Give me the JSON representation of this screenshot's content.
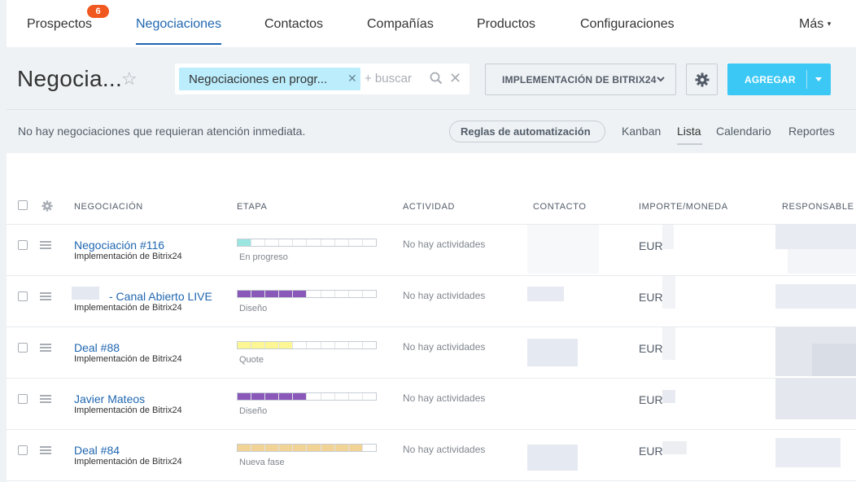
{
  "topnav": {
    "items": [
      {
        "label": "Prospectos",
        "badge": "6"
      },
      {
        "label": "Negociaciones"
      },
      {
        "label": "Contactos"
      },
      {
        "label": "Compañías"
      },
      {
        "label": "Productos"
      },
      {
        "label": "Configuraciones"
      }
    ],
    "more_label": "Más"
  },
  "header": {
    "title": "Negocia...",
    "filter_chip": "Negociaciones en progr...",
    "search_placeholder": "+ buscar",
    "category_button": "IMPLEMENTACIÓN DE BITRIX24",
    "add_button": "AGREGAR"
  },
  "info": {
    "message": "No hay negociaciones que requieran atención inmediata.",
    "rules_button": "Reglas de automatización",
    "views": [
      "Kanban",
      "Lista",
      "Calendario",
      "Reportes"
    ],
    "active_view": "Lista"
  },
  "grid": {
    "columns": [
      "NEGOCIACIÓN",
      "ETAPA",
      "ACTIVIDAD",
      "CONTACTO",
      "IMPORTE/MONEDA",
      "RESPONSABLE"
    ],
    "rows": [
      {
        "title": "Negociación #116",
        "subtitle": "Implementación de Bitrix24",
        "stage": "En progreso",
        "stage_progress": 0.1,
        "stage_color": "#9be5e0",
        "activity": "No hay actividades",
        "currency": "EUR"
      },
      {
        "title": "- Canal Abierto LIVE",
        "subtitle": "Implementación de Bitrix24",
        "stage": "Diseño",
        "stage_progress": 0.55,
        "stage_color": "#8a58b9",
        "activity": "No hay actividades",
        "currency": "EUR"
      },
      {
        "title": "Deal #88",
        "subtitle": "Implementación de Bitrix24",
        "stage": "Quote",
        "stage_progress": 0.45,
        "stage_color": "#fdf694",
        "activity": "No hay actividades",
        "currency": "EUR"
      },
      {
        "title": "Javier Mateos",
        "subtitle": "Implementación de Bitrix24",
        "stage": "Diseño",
        "stage_progress": 0.55,
        "stage_color": "#8a58b9",
        "activity": "No hay actividades",
        "currency": "EUR"
      },
      {
        "title": "Deal #84",
        "subtitle": "Implementación de Bitrix24",
        "stage": "Nueva fase",
        "stage_progress": 0.9,
        "stage_color": "#f2d396",
        "activity": "No hay actividades",
        "currency": "EUR"
      }
    ]
  },
  "colors": {
    "accent": "#2067b0",
    "add_button": "#3bc8f5",
    "badge": "#f0581f"
  }
}
